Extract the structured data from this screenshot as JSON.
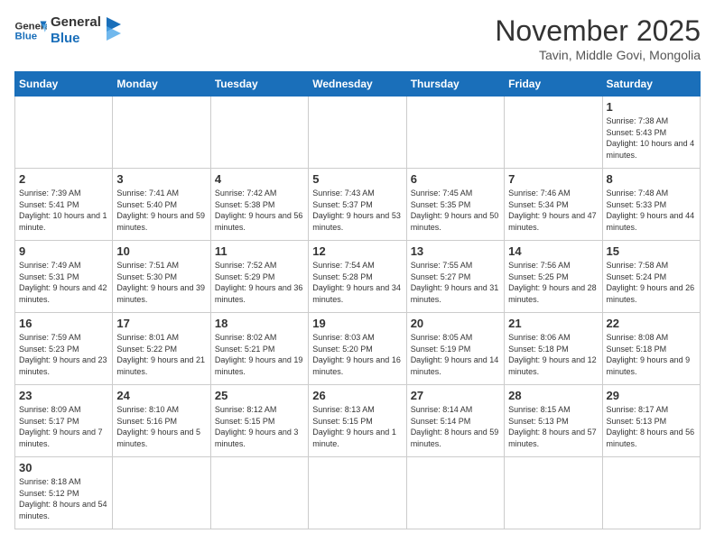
{
  "header": {
    "logo_general": "General",
    "logo_blue": "Blue",
    "month_title": "November 2025",
    "location": "Tavin, Middle Govi, Mongolia"
  },
  "days_of_week": [
    "Sunday",
    "Monday",
    "Tuesday",
    "Wednesday",
    "Thursday",
    "Friday",
    "Saturday"
  ],
  "weeks": [
    [
      null,
      null,
      null,
      null,
      null,
      null,
      {
        "day": "1",
        "sunrise": "7:38 AM",
        "sunset": "5:43 PM",
        "daylight": "10 hours and 4 minutes."
      }
    ],
    [
      {
        "day": "2",
        "sunrise": "7:39 AM",
        "sunset": "5:41 PM",
        "daylight": "10 hours and 1 minute."
      },
      {
        "day": "3",
        "sunrise": "7:41 AM",
        "sunset": "5:40 PM",
        "daylight": "9 hours and 59 minutes."
      },
      {
        "day": "4",
        "sunrise": "7:42 AM",
        "sunset": "5:38 PM",
        "daylight": "9 hours and 56 minutes."
      },
      {
        "day": "5",
        "sunrise": "7:43 AM",
        "sunset": "5:37 PM",
        "daylight": "9 hours and 53 minutes."
      },
      {
        "day": "6",
        "sunrise": "7:45 AM",
        "sunset": "5:35 PM",
        "daylight": "9 hours and 50 minutes."
      },
      {
        "day": "7",
        "sunrise": "7:46 AM",
        "sunset": "5:34 PM",
        "daylight": "9 hours and 47 minutes."
      },
      {
        "day": "8",
        "sunrise": "7:48 AM",
        "sunset": "5:33 PM",
        "daylight": "9 hours and 44 minutes."
      }
    ],
    [
      {
        "day": "9",
        "sunrise": "7:49 AM",
        "sunset": "5:31 PM",
        "daylight": "9 hours and 42 minutes."
      },
      {
        "day": "10",
        "sunrise": "7:51 AM",
        "sunset": "5:30 PM",
        "daylight": "9 hours and 39 minutes."
      },
      {
        "day": "11",
        "sunrise": "7:52 AM",
        "sunset": "5:29 PM",
        "daylight": "9 hours and 36 minutes."
      },
      {
        "day": "12",
        "sunrise": "7:54 AM",
        "sunset": "5:28 PM",
        "daylight": "9 hours and 34 minutes."
      },
      {
        "day": "13",
        "sunrise": "7:55 AM",
        "sunset": "5:27 PM",
        "daylight": "9 hours and 31 minutes."
      },
      {
        "day": "14",
        "sunrise": "7:56 AM",
        "sunset": "5:25 PM",
        "daylight": "9 hours and 28 minutes."
      },
      {
        "day": "15",
        "sunrise": "7:58 AM",
        "sunset": "5:24 PM",
        "daylight": "9 hours and 26 minutes."
      }
    ],
    [
      {
        "day": "16",
        "sunrise": "7:59 AM",
        "sunset": "5:23 PM",
        "daylight": "9 hours and 23 minutes."
      },
      {
        "day": "17",
        "sunrise": "8:01 AM",
        "sunset": "5:22 PM",
        "daylight": "9 hours and 21 minutes."
      },
      {
        "day": "18",
        "sunrise": "8:02 AM",
        "sunset": "5:21 PM",
        "daylight": "9 hours and 19 minutes."
      },
      {
        "day": "19",
        "sunrise": "8:03 AM",
        "sunset": "5:20 PM",
        "daylight": "9 hours and 16 minutes."
      },
      {
        "day": "20",
        "sunrise": "8:05 AM",
        "sunset": "5:19 PM",
        "daylight": "9 hours and 14 minutes."
      },
      {
        "day": "21",
        "sunrise": "8:06 AM",
        "sunset": "5:18 PM",
        "daylight": "9 hours and 12 minutes."
      },
      {
        "day": "22",
        "sunrise": "8:08 AM",
        "sunset": "5:18 PM",
        "daylight": "9 hours and 9 minutes."
      }
    ],
    [
      {
        "day": "23",
        "sunrise": "8:09 AM",
        "sunset": "5:17 PM",
        "daylight": "9 hours and 7 minutes."
      },
      {
        "day": "24",
        "sunrise": "8:10 AM",
        "sunset": "5:16 PM",
        "daylight": "9 hours and 5 minutes."
      },
      {
        "day": "25",
        "sunrise": "8:12 AM",
        "sunset": "5:15 PM",
        "daylight": "9 hours and 3 minutes."
      },
      {
        "day": "26",
        "sunrise": "8:13 AM",
        "sunset": "5:15 PM",
        "daylight": "9 hours and 1 minute."
      },
      {
        "day": "27",
        "sunrise": "8:14 AM",
        "sunset": "5:14 PM",
        "daylight": "8 hours and 59 minutes."
      },
      {
        "day": "28",
        "sunrise": "8:15 AM",
        "sunset": "5:13 PM",
        "daylight": "8 hours and 57 minutes."
      },
      {
        "day": "29",
        "sunrise": "8:17 AM",
        "sunset": "5:13 PM",
        "daylight": "8 hours and 56 minutes."
      }
    ],
    [
      {
        "day": "30",
        "sunrise": "8:18 AM",
        "sunset": "5:12 PM",
        "daylight": "8 hours and 54 minutes."
      },
      null,
      null,
      null,
      null,
      null,
      null
    ]
  ]
}
